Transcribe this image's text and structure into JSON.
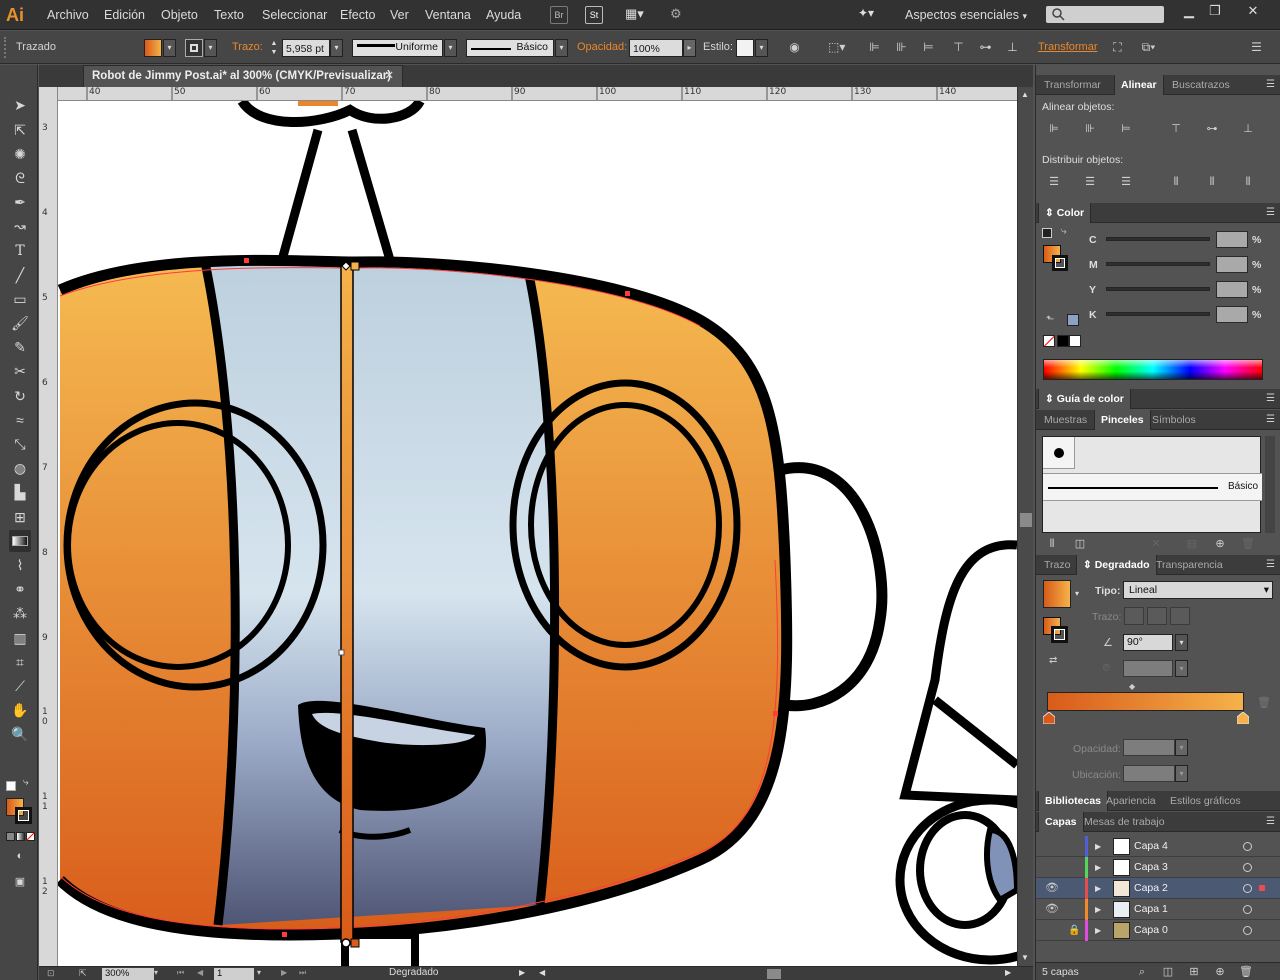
{
  "menubar": {
    "logo": "Ai",
    "items": [
      "Archivo",
      "Edición",
      "Objeto",
      "Texto",
      "Seleccionar",
      "Efecto",
      "Ver",
      "Ventana",
      "Ayuda"
    ],
    "bridge_label": "Br",
    "stock_label": "St",
    "workspace": "Aspectos esenciales"
  },
  "controlbar": {
    "selection_type": "Trazado",
    "stroke_label": "Trazo:",
    "stroke_weight": "5,958 pt",
    "profile": "Uniforme",
    "brush": "Básico",
    "opacity_label": "Opacidad:",
    "opacity": "100%",
    "style_label": "Estilo:",
    "transform_label": "Transformar"
  },
  "document": {
    "tab_title": "Robot de Jimmy Post.ai* al 300% (CMYK/Previsualizar)",
    "ruler_h": [
      "40",
      "50",
      "60",
      "70",
      "80",
      "90",
      "100",
      "110",
      "120",
      "130",
      "140"
    ],
    "ruler_v": [
      "3",
      "4",
      "5",
      "6",
      "7",
      "8",
      "9",
      "1 0",
      "1 1",
      "1 2"
    ],
    "zoom": "300%",
    "page": "1",
    "status_tool": "Degradado"
  },
  "panels": {
    "align_tabs": [
      "Transformar",
      "Alinear",
      "Buscatrazos"
    ],
    "align_objects_label": "Alinear objetos:",
    "distribute_objects_label": "Distribuir objetos:",
    "color_tab": "Color",
    "color_channels": [
      "C",
      "M",
      "Y",
      "K"
    ],
    "color_pct": "%",
    "color_guide_tab": "Guía de color",
    "brush_tabs": [
      "Muestras",
      "Pinceles",
      "Símbolos"
    ],
    "brush_basic": "Básico",
    "gradient_tabs": [
      "Trazo",
      "Degradado",
      "Transparencia"
    ],
    "type_label": "Tipo:",
    "type_value": "Lineal",
    "stroke_label": "Trazo:",
    "angle": "90°",
    "opacity_label": "Opacidad:",
    "location_label": "Ubicación:",
    "library_tabs": [
      "Bibliotecas",
      "Apariencia",
      "Estilos gráficos"
    ],
    "layer_tabs": [
      "Capas",
      "Mesas de trabajo"
    ],
    "layers": [
      {
        "name": "Capa 4",
        "color": "#4f5fd8",
        "visible": false,
        "locked": false,
        "selected": false
      },
      {
        "name": "Capa 3",
        "color": "#54d65a",
        "visible": false,
        "locked": false,
        "selected": false
      },
      {
        "name": "Capa 2",
        "color": "#e94c4c",
        "visible": true,
        "locked": false,
        "selected": true
      },
      {
        "name": "Capa 1",
        "color": "#f08a2a",
        "visible": true,
        "locked": false,
        "selected": false
      },
      {
        "name": "Capa 0",
        "color": "#e24be0",
        "visible": false,
        "locked": true,
        "selected": false
      }
    ],
    "layers_count": "5 capas"
  },
  "colors": {
    "accent_orange": "#e8872c",
    "gradient_start": "#d85b1a",
    "gradient_end": "#f5b24a",
    "panel_bg": "#535353",
    "selection_row": "#4b5972"
  }
}
